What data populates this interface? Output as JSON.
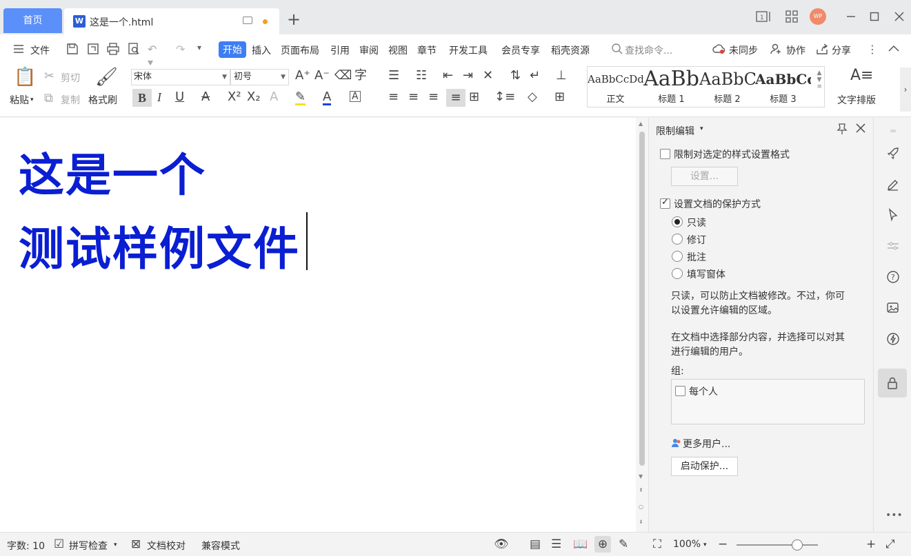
{
  "tabs": {
    "home": "首页",
    "document": "这是一个.html",
    "new_tab": "+"
  },
  "titlebar": {
    "avatar": "WP"
  },
  "menu": {
    "file": "文件",
    "items": [
      "开始",
      "插入",
      "页面布局",
      "引用",
      "审阅",
      "视图",
      "章节",
      "开发工具",
      "会员专享",
      "稻壳资源"
    ],
    "search_placeholder": "查找命令...",
    "sync": "未同步",
    "collab": "协作",
    "share": "分享"
  },
  "ribbon": {
    "paste": "粘贴",
    "cut": "剪切",
    "copy": "复制",
    "format_painter": "格式刷",
    "font_name": "宋体",
    "font_size": "初号",
    "styles": [
      {
        "preview": "AaBbCcDd",
        "label": "正文"
      },
      {
        "preview": "AaBb",
        "label": "标题 1"
      },
      {
        "preview": "AaBbC",
        "label": "标题 2"
      },
      {
        "preview": "AaBbCcI",
        "label": "标题 3"
      }
    ],
    "text_layout": "文字排版"
  },
  "document": {
    "line1": "这是一个",
    "line2": "测试样例文件"
  },
  "panel": {
    "title": "限制编辑",
    "restrict_format": "限制对选定的样式设置格式",
    "settings_btn": "设置...",
    "protect_doc": "设置文档的保护方式",
    "options": [
      "只读",
      "修订",
      "批注",
      "填写窗体"
    ],
    "desc1_line1": "只读，可以防止文档被修改。不过，你可",
    "desc1_line2": "以设置允许编辑的区域。",
    "desc2_line1": "在文档中选择部分内容，并选择可以对其",
    "desc2_line2": "进行编辑的用户。",
    "group_label": "组:",
    "everyone": "每个人",
    "more_users": "更多用户...",
    "start_protect": "启动保护..."
  },
  "status": {
    "word_count": "字数: 10",
    "spell_check": "拼写检查",
    "doc_proof": "文档校对",
    "compat_mode": "兼容模式",
    "zoom": "100%"
  },
  "colors": {
    "accent": "#3d7df5",
    "home_tab": "#5b8ff9",
    "doc_text": "#0a1ed2"
  }
}
